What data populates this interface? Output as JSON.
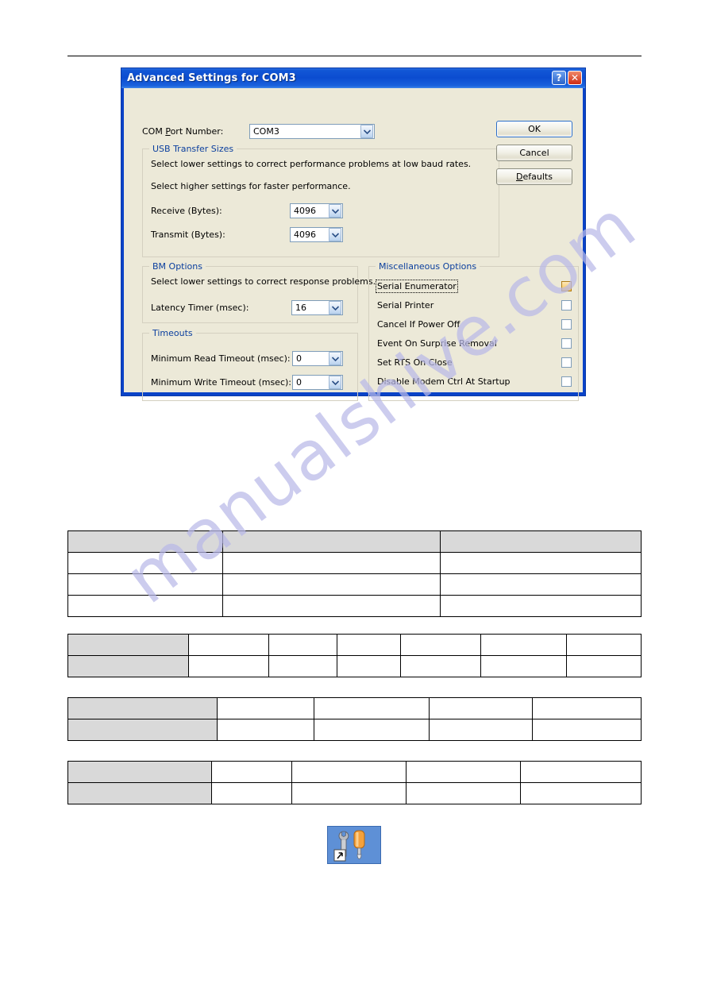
{
  "document": {
    "watermark": "manualshive.com"
  },
  "dialog": {
    "title": "Advanced Settings for COM3",
    "titlebar_buttons": [
      {
        "name": "help-button",
        "glyph": "?"
      },
      {
        "name": "close-button",
        "glyph": "✕"
      }
    ],
    "com_port": {
      "label_pre": "COM ",
      "label_accel": "P",
      "label_post": "ort Number:",
      "value": "COM3"
    },
    "buttons": [
      {
        "label": "OK",
        "focused": true
      },
      {
        "label": "Cancel",
        "focused": false
      },
      {
        "label": "Defaults",
        "focused": false,
        "accel": "D"
      }
    ],
    "usb_transfer_sizes": {
      "legend": "USB Transfer Sizes",
      "line1": "Select lower settings to correct performance problems at low baud rates.",
      "line2": "Select higher settings for faster performance.",
      "fields": [
        {
          "label": "Receive (Bytes):",
          "value": "4096"
        },
        {
          "label": "Transmit (Bytes):",
          "value": "4096"
        }
      ]
    },
    "bm_options": {
      "legend": "BM Options",
      "line1": "Select lower settings to correct response problems.",
      "fields": [
        {
          "label": "Latency Timer (msec):",
          "value": "16"
        }
      ]
    },
    "timeouts": {
      "legend": "Timeouts",
      "fields": [
        {
          "label": "Minimum Read Timeout (msec):",
          "value": "0"
        },
        {
          "label": "Minimum Write Timeout (msec):",
          "value": "0"
        }
      ]
    },
    "misc_options": {
      "legend": "Miscellaneous Options",
      "items": [
        {
          "label": "Serial Enumerator",
          "highlighted": true,
          "focused": true
        },
        {
          "label": "Serial Printer",
          "highlighted": false,
          "focused": false
        },
        {
          "label": "Cancel If Power Off",
          "highlighted": false,
          "focused": false
        },
        {
          "label": "Event On Surprise Removal",
          "highlighted": false,
          "focused": false
        },
        {
          "label": "Set RTS On Close",
          "highlighted": false,
          "focused": false
        },
        {
          "label": "Disable Modem Ctrl At Startup",
          "highlighted": false,
          "focused": false
        }
      ]
    },
    "colors": {
      "titlebar": "#0b4cd0",
      "body": "#ece9d8",
      "legend_text": "#0b3f9e",
      "check_highlight": "#f7c14b",
      "frame": "#0a43c8"
    }
  },
  "tables": [
    {
      "name": "table-1",
      "col_widths": [
        "27%",
        "38%",
        "35%"
      ],
      "rows": [
        {
          "shaded": true,
          "cells": [
            "",
            "",
            ""
          ]
        },
        {
          "shaded": false,
          "cells": [
            "",
            "",
            ""
          ]
        },
        {
          "shaded": false,
          "cells": [
            "",
            "",
            ""
          ]
        },
        {
          "shaded": false,
          "cells": [
            "",
            "",
            ""
          ]
        }
      ]
    },
    {
      "name": "table-2",
      "col_widths": [
        "21%",
        "14%",
        "12%",
        "11%",
        "14%",
        "15%",
        "13%"
      ],
      "rows": [
        {
          "first_shaded": true,
          "cells": [
            "",
            "",
            "",
            "",
            "",
            "",
            ""
          ]
        },
        {
          "first_shaded": true,
          "cells": [
            "",
            "",
            "",
            "",
            "",
            "",
            ""
          ]
        }
      ]
    },
    {
      "name": "table-3",
      "col_widths": [
        "26%",
        "17%",
        "20%",
        "18%",
        "19%"
      ],
      "rows": [
        {
          "first_shaded": true,
          "cells": [
            "",
            "",
            "",
            "",
            ""
          ]
        },
        {
          "first_shaded": true,
          "cells": [
            "",
            "",
            "",
            "",
            ""
          ]
        }
      ]
    },
    {
      "name": "table-4",
      "col_widths": [
        "25%",
        "14%",
        "20%",
        "20%",
        "21%"
      ],
      "rows": [
        {
          "first_shaded": true,
          "cells": [
            "",
            "",
            "",
            "",
            ""
          ]
        },
        {
          "first_shaded": true,
          "cells": [
            "",
            "",
            "",
            "",
            ""
          ]
        }
      ]
    }
  ],
  "tools_icon": {
    "name": "tools-shortcut-icon",
    "description": "wrench-and-screwdriver",
    "background": "#5e90d6"
  }
}
